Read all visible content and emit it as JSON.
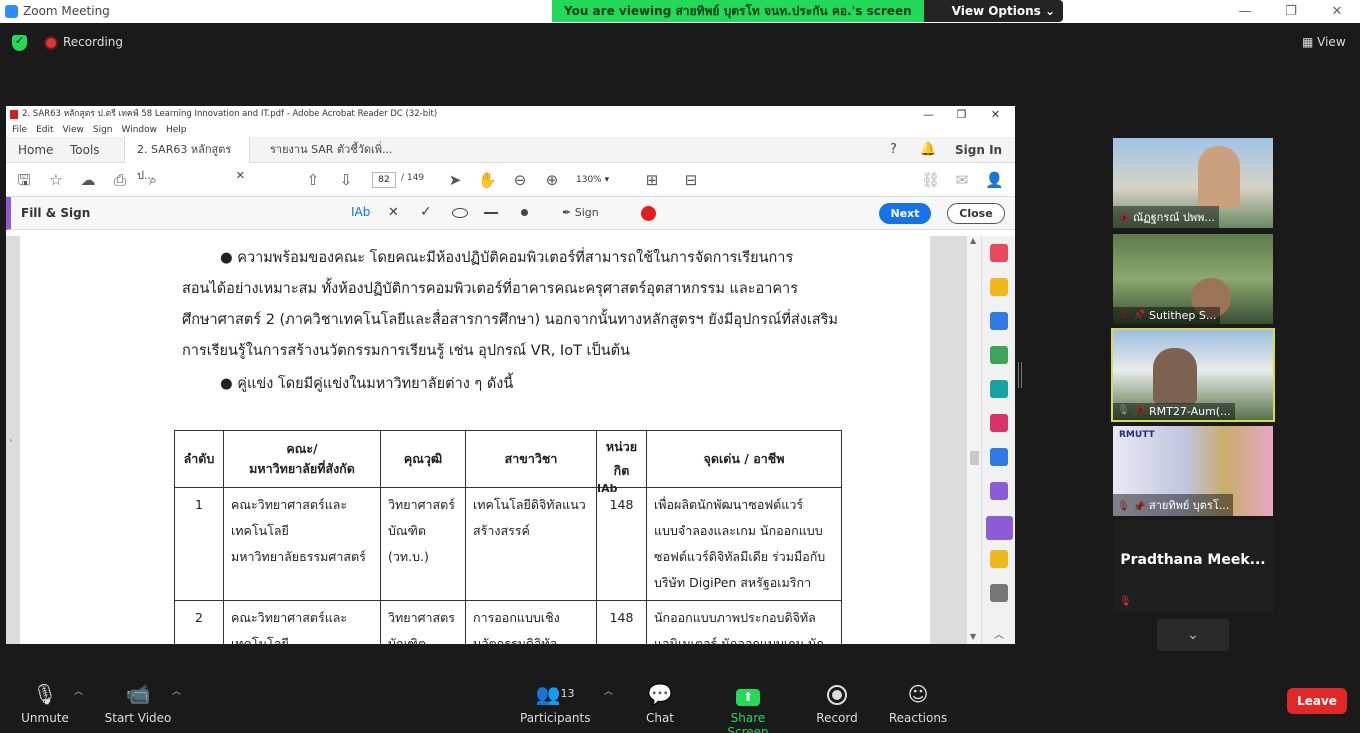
{
  "zoom": {
    "window_title": "Zoom Meeting",
    "viewing_banner": "You are viewing สายทิพย์ บุตรโท จนท.ประกัน คอ.'s screen",
    "view_options": "View Options ⌄",
    "recording": "Recording",
    "view_label": "View"
  },
  "acrobat": {
    "window_title": "2. SAR63 หลักสูตร ป.ตรี เทคฟ์ 58 Learning Innovation and IT.pdf - Adobe Acrobat Reader DC (32-bit)",
    "menu": [
      "File",
      "Edit",
      "View",
      "Sign",
      "Window",
      "Help"
    ],
    "tabs": {
      "home": "Home",
      "tools": "Tools",
      "doc1": "2. SAR63 หลักสูตร ป...",
      "doc2": "รายงาน SAR ตัวชี้วัดเพิ่..."
    },
    "sign_in": "Sign In",
    "page_current": "82",
    "page_total": "/ 149",
    "zoom_level": "130%",
    "fill_sign": {
      "title": "Fill & Sign",
      "text_tool": "Ab",
      "sign": "Sign",
      "next": "Next",
      "close": "Close"
    }
  },
  "document": {
    "p1": "●  ความพร้อมของคณะ โดยคณะมีห้องปฏิบัติคอมพิวเตอร์ที่สามารถใช้ในการจัดการเรียนการ",
    "p2": "สอนได้อย่างเหมาะสม ทั้งห้องปฏิบัติการคอมพิวเตอร์ที่อาคารคณะครุศาสตร์อุตสาหกรรม และอาคาร",
    "p3": "ศึกษาศาสตร์ 2 (ภาควิชาเทคโนโลยีและสื่อสารการศึกษา) นอกจากนั้นทางหลักสูตรฯ ยังมีอุปกรณ์ที่ส่งเสริม",
    "p4": "การเรียนรู้ในการสร้างนวัตกรรมการเรียนรู้ เช่น อุปกรณ์ VR, IoT เป็นต้น",
    "p5": "●  คู่แข่ง โดยมีคู่แข่งในมหาวิทยาลัยต่าง ๆ ดังนี้",
    "table": {
      "headers": [
        "ลำดับ",
        "คณะ/\nมหาวิทยาลัยที่สังกัด",
        "คุณวุฒิ",
        "สาขาวิชา",
        "หน่วย\nกิต",
        "จุดเด่น / อาชีพ"
      ],
      "rows": [
        [
          "1",
          "คณะวิทยาศาสตร์และ\nเทคโนโลยี\nมหาวิทยาลัยธรรมศาสตร์",
          "วิทยาศาสตร์\nบัณฑิต\n(วท.บ.)",
          "เทคโนโลยีดิจิทัลแนว\nสร้างสรรค์",
          "148",
          "เพื่อผลิตนักพัฒนาซอฟต์แวร์\nแบบจำลองและเกม นักออกแบบ\nซอฟต์แวร์ดิจิทัลมีเดีย ร่วมมือกับ\nบริษัท DigiPen สหรัฐอเมริกา"
        ],
        [
          "2",
          "คณะวิทยาศาสตร์และ\nเทคโนโลยี",
          "วิทยาศาสตร\nบัณฑิต",
          "การออกแบบเชิง\nนวัตกรรมดิจิทัล",
          "148",
          "นักออกแบบภาพประกอบดิจิทัล\nแอนิเมเตอร์ นักออกแบบเกม นัก"
        ]
      ]
    },
    "cursor_label": "Ab"
  },
  "participants": [
    {
      "name": "ณัฏฐกรณ์ ปพพ...",
      "bg": "#5f7f9c"
    },
    {
      "name": "Sutithep S...",
      "bg": "#4f6a3d"
    },
    {
      "name": "RMT27-Aum(...",
      "bg": "#6b7d95"
    },
    {
      "name": "สายทิพย์ บุตรโ...",
      "bg": "#8c8fa8"
    },
    {
      "name": "Pradthana  Meek...",
      "bg": "#1f1f1f"
    }
  ],
  "bottom_bar": {
    "unmute": "Unmute",
    "start_video": "Start Video",
    "participants": "Participants",
    "participant_count": "13",
    "chat": "Chat",
    "share_screen": "Share Screen",
    "record": "Record",
    "reactions": "Reactions",
    "leave": "Leave"
  },
  "colors": {
    "accent_green": "#23d959",
    "leave_red": "#e02828",
    "adobe_blue": "#1473e6",
    "fill_sign_purple": "#8c5bd6"
  }
}
